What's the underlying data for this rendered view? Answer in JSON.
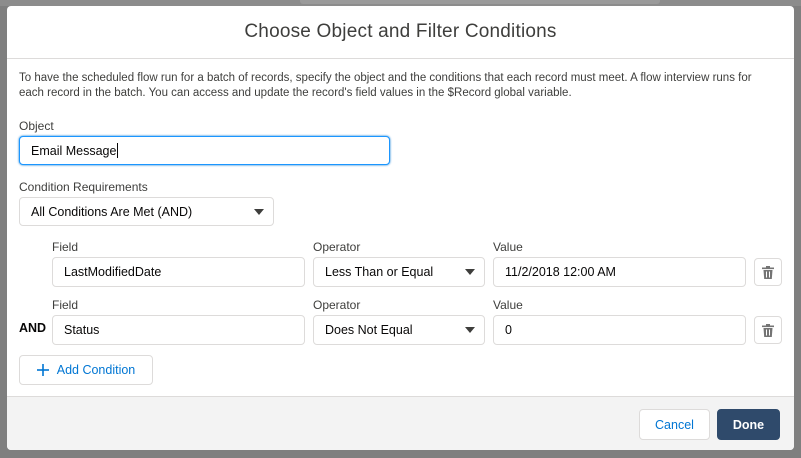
{
  "modal": {
    "title": "Choose Object and Filter Conditions",
    "description": "To have the scheduled flow run for a batch of records, specify the object and the conditions that each record must meet. A flow interview runs for each record in the batch. You can access and update the record's field values in the $Record global variable."
  },
  "object": {
    "label": "Object",
    "value": "Email Message"
  },
  "condition_requirements": {
    "label": "Condition Requirements",
    "value": "All Conditions Are Met (AND)"
  },
  "conditions": [
    {
      "field_label": "Field",
      "field": "LastModifiedDate",
      "operator_label": "Operator",
      "operator": "Less Than or Equal",
      "value_label": "Value",
      "value": "11/2/2018 12:00 AM"
    },
    {
      "logic": "AND",
      "field_label": "Field",
      "field": "Status",
      "operator_label": "Operator",
      "operator": "Does Not Equal",
      "value_label": "Value",
      "value": "0"
    }
  ],
  "add_condition_label": "Add Condition",
  "footer": {
    "cancel_label": "Cancel",
    "done_label": "Done"
  },
  "colors": {
    "brand_button": "#2f4a6b",
    "link_blue": "#0176d3",
    "focus_border": "#1b96ff",
    "footer_bg": "#f3f3f3"
  },
  "icons": {
    "delete": "trash-icon",
    "add": "plus-icon",
    "dropdown": "chevron-down-icon"
  }
}
